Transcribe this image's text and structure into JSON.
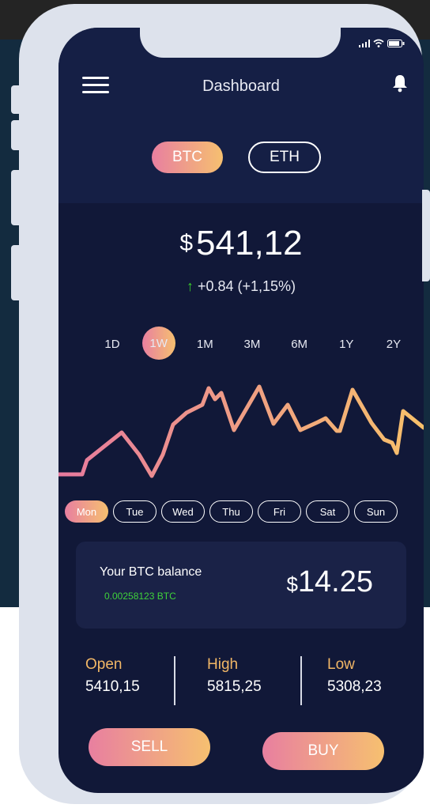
{
  "header": {
    "title": "Dashboard"
  },
  "coins": {
    "btc": "BTC",
    "eth": "ETH"
  },
  "price": {
    "currency": "$",
    "value": "541,12",
    "change_text": "+0.84 (+1,15%)"
  },
  "ranges": [
    "1D",
    "1W",
    "1M",
    "3M",
    "6M",
    "1Y",
    "2Y"
  ],
  "days": [
    "Mon",
    "Tue",
    "Wed",
    "Thu",
    "Fri",
    "Sat",
    "Sun"
  ],
  "balance": {
    "label": "Your BTC balance",
    "btc": "0.00258123 BTC",
    "currency": "$",
    "amount": "14.25"
  },
  "stats": [
    {
      "label": "Open",
      "value": "5410,15"
    },
    {
      "label": "High",
      "value": "5815,25"
    },
    {
      "label": "Low",
      "value": "5308,23"
    }
  ],
  "actions": {
    "sell": "SELL",
    "buy": "BUY"
  },
  "colors": {
    "accent_start": "#e87fa0",
    "accent_end": "#f6c070",
    "positive": "#39d02a",
    "screen_bg": "#111838"
  },
  "icons": [
    "menu-icon",
    "bell-icon",
    "signal-icon",
    "wifi-icon",
    "battery-icon",
    "arrow-up-icon"
  ]
}
